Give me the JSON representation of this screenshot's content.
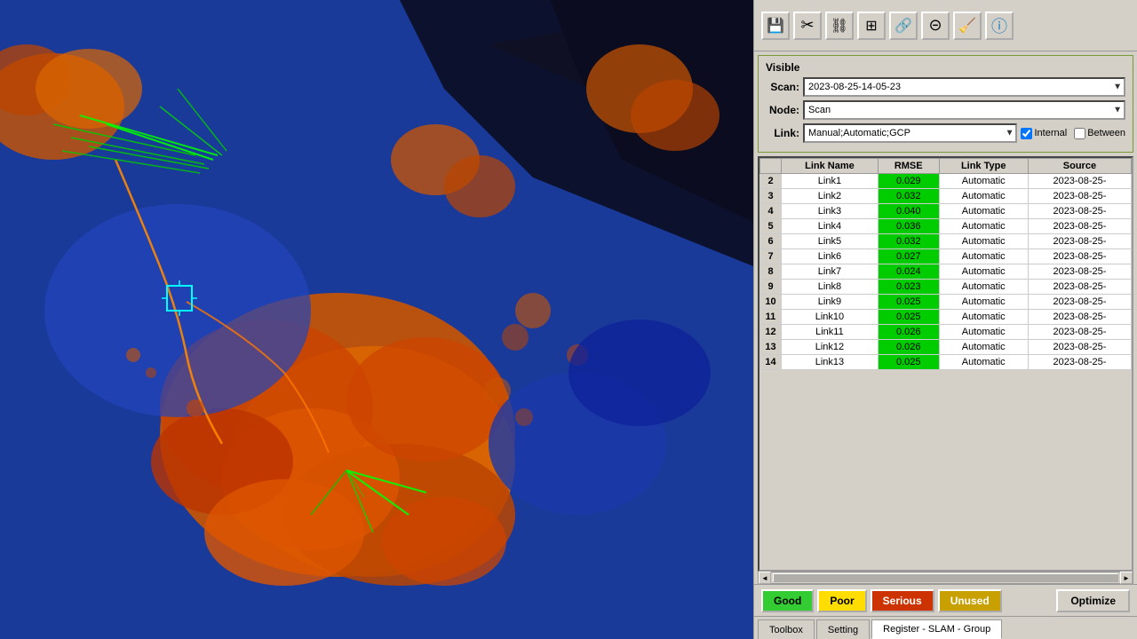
{
  "toolbar": {
    "buttons": [
      {
        "name": "save-icon",
        "symbol": "💾"
      },
      {
        "name": "cursor-icon",
        "symbol": "✂"
      },
      {
        "name": "link-icon",
        "symbol": "🔗"
      },
      {
        "name": "grid-icon",
        "symbol": "⊞"
      },
      {
        "name": "chain-icon",
        "symbol": "🔗"
      },
      {
        "name": "circle-icon",
        "symbol": "⊙"
      },
      {
        "name": "broom-icon",
        "symbol": "🧹"
      },
      {
        "name": "info-icon",
        "symbol": "ℹ"
      }
    ]
  },
  "visible_section": {
    "title": "Visible",
    "scan_label": "Scan:",
    "scan_value": "2023-08-25-14-05-23",
    "node_label": "Node:",
    "node_value": "Scan",
    "link_label": "Link:",
    "link_value": "Manual;Automatic;GCP",
    "internal_label": "Internal",
    "between_label": "Between",
    "internal_checked": true,
    "between_checked": false
  },
  "table": {
    "columns": [
      "",
      "Link Name",
      "RMSE",
      "Link Type",
      "Source"
    ],
    "rows": [
      {
        "index": "2",
        "name": "Link1",
        "rmse": "0.029",
        "type": "Automatic",
        "source": "2023-08-25-"
      },
      {
        "index": "3",
        "name": "Link2",
        "rmse": "0.032",
        "type": "Automatic",
        "source": "2023-08-25-"
      },
      {
        "index": "4",
        "name": "Link3",
        "rmse": "0.040",
        "type": "Automatic",
        "source": "2023-08-25-"
      },
      {
        "index": "5",
        "name": "Link4",
        "rmse": "0.036",
        "type": "Automatic",
        "source": "2023-08-25-"
      },
      {
        "index": "6",
        "name": "Link5",
        "rmse": "0.032",
        "type": "Automatic",
        "source": "2023-08-25-"
      },
      {
        "index": "7",
        "name": "Link6",
        "rmse": "0.027",
        "type": "Automatic",
        "source": "2023-08-25-"
      },
      {
        "index": "8",
        "name": "Link7",
        "rmse": "0.024",
        "type": "Automatic",
        "source": "2023-08-25-"
      },
      {
        "index": "9",
        "name": "Link8",
        "rmse": "0.023",
        "type": "Automatic",
        "source": "2023-08-25-"
      },
      {
        "index": "10",
        "name": "Link9",
        "rmse": "0.025",
        "type": "Automatic",
        "source": "2023-08-25-"
      },
      {
        "index": "11",
        "name": "Link10",
        "rmse": "0.025",
        "type": "Automatic",
        "source": "2023-08-25-"
      },
      {
        "index": "12",
        "name": "Link11",
        "rmse": "0.026",
        "type": "Automatic",
        "source": "2023-08-25-"
      },
      {
        "index": "13",
        "name": "Link12",
        "rmse": "0.026",
        "type": "Automatic",
        "source": "2023-08-25-"
      },
      {
        "index": "14",
        "name": "Link13",
        "rmse": "0.025",
        "type": "Automatic",
        "source": "2023-08-25-"
      }
    ]
  },
  "legend": {
    "good_label": "Good",
    "poor_label": "Poor",
    "serious_label": "Serious",
    "unused_label": "Unused",
    "optimize_label": "Optimize"
  },
  "bottom_tabs": [
    {
      "label": "Toolbox",
      "active": false
    },
    {
      "label": "Setting",
      "active": false
    },
    {
      "label": "Register - SLAM - Group",
      "active": true
    }
  ]
}
